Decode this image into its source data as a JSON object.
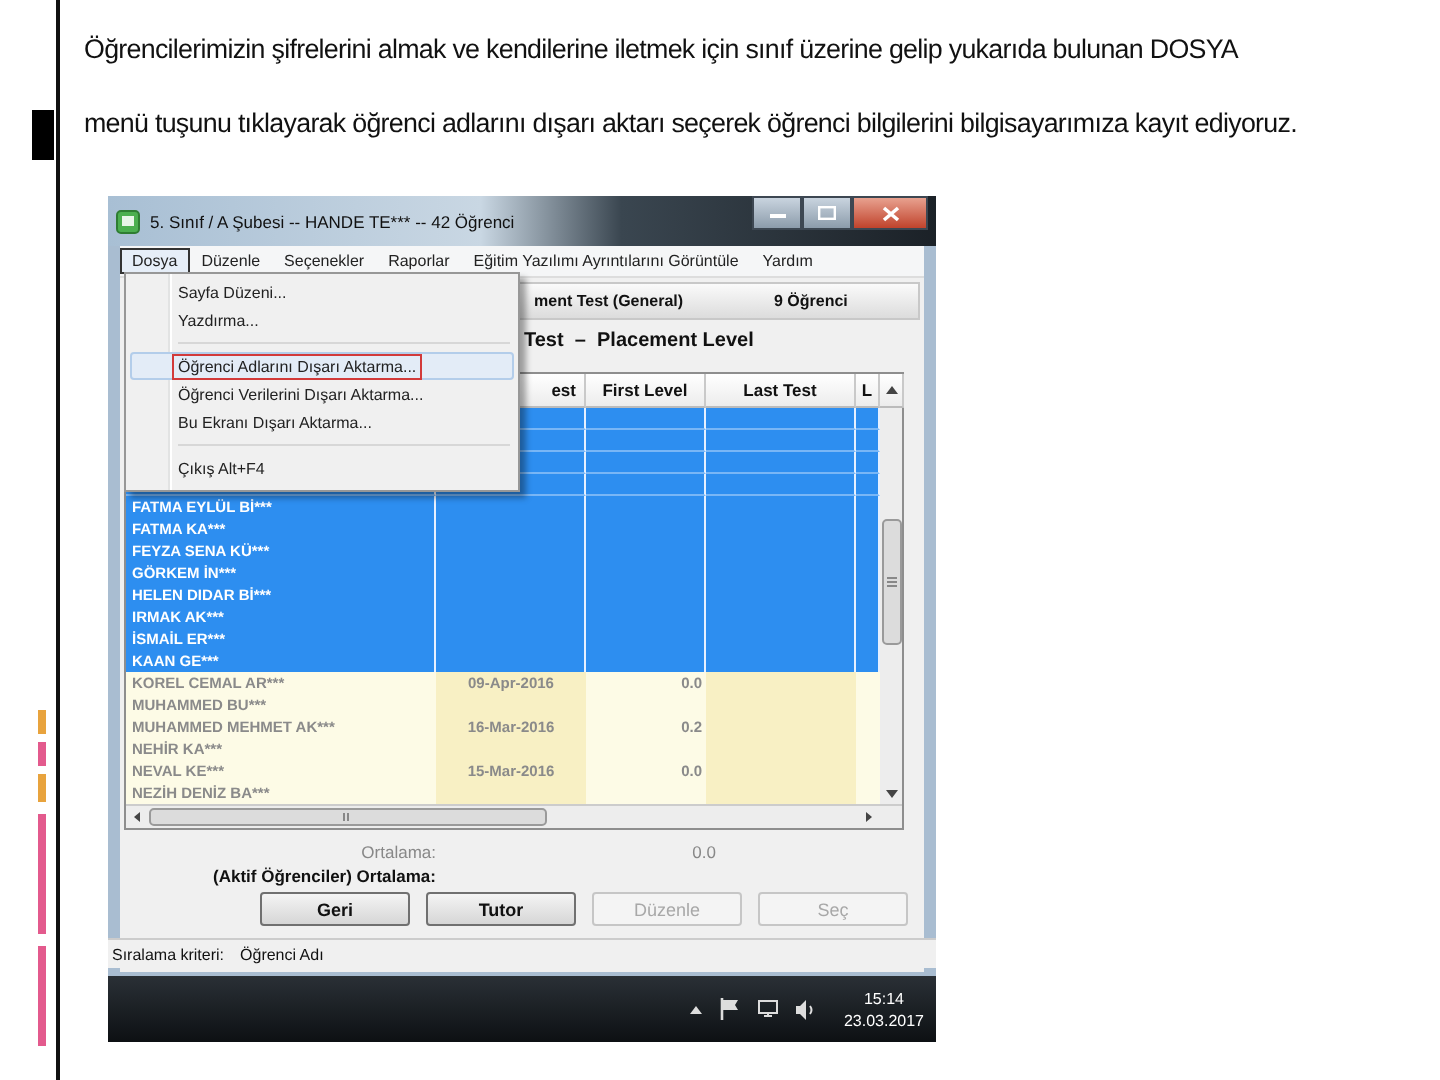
{
  "slide": {
    "lines": [
      "Öğrencilerimizin şifrelerini almak ve kendilerine  iletmek için sınıf üzerine gelip yukarıda bulunan DOSYA",
      "menü tuşunu tıklayarak öğrenci adlarını dışarı aktarı seçerek öğrenci bilgilerini bilgisayarımıza kayıt ediyoruz."
    ]
  },
  "window": {
    "title": "5. Sınıf / A Şubesi -- HANDE TE*** -- 42 Öğrenci"
  },
  "menu_bar": [
    {
      "label": "Dosya",
      "selected": true
    },
    {
      "label": "Düzenle",
      "selected": false
    },
    {
      "label": "Seçenekler",
      "selected": false
    },
    {
      "label": "Raporlar",
      "selected": false
    },
    {
      "label": "Eğitim Yazılımı Ayrıntılarını Görüntüle",
      "selected": false
    },
    {
      "label": "Yardım",
      "selected": false
    }
  ],
  "dropdown": [
    {
      "kind": "item",
      "label": "Sayfa Düzeni...",
      "selected": false,
      "outlined": false
    },
    {
      "kind": "item",
      "label": "Yazdırma...",
      "selected": false,
      "outlined": false
    },
    {
      "kind": "separator"
    },
    {
      "kind": "item",
      "label": "Öğrenci Adlarını Dışarı Aktarma...",
      "selected": true,
      "outlined": true
    },
    {
      "kind": "item",
      "label": "Öğrenci Verilerini Dışarı Aktarma...",
      "selected": false,
      "outlined": false
    },
    {
      "kind": "item",
      "label": "Bu Ekranı Dışarı Aktarma...",
      "selected": false,
      "outlined": false
    },
    {
      "kind": "separator"
    },
    {
      "kind": "item",
      "label": "Çıkış Alt+F4",
      "selected": false,
      "outlined": false
    }
  ],
  "test_info": {
    "name": "ment Test (General)",
    "count": "9 Öğrenci"
  },
  "subtitle": "Test  –  Placement Level",
  "table": {
    "columns": [
      "est",
      "First Level",
      "Last Test",
      "L"
    ],
    "rows": [
      {
        "selected": true
      },
      {
        "selected": true
      },
      {
        "selected": true
      },
      {
        "selected": true
      },
      {
        "name": "FATMA EYLÜL Bİ***",
        "selected": true
      },
      {
        "name": "FATMA KA***",
        "selected": true
      },
      {
        "name": "FEYZA SENA KÜ***",
        "selected": true
      },
      {
        "name": "GÖRKEM İN***",
        "selected": true
      },
      {
        "name": "HELEN DIDAR Bİ***",
        "selected": true
      },
      {
        "name": "IRMAK AK***",
        "selected": true
      },
      {
        "name": "İSMAİL ER***",
        "selected": true
      },
      {
        "name": "KAAN GE***",
        "selected": true
      },
      {
        "name": "KOREL CEMAL AR***",
        "test": "09-Apr-2016",
        "first_level": "0.0",
        "selected": false
      },
      {
        "name": "MUHAMMED BU***",
        "selected": false
      },
      {
        "name": "MUHAMMED MEHMET AK***",
        "test": "16-Mar-2016",
        "first_level": "0.2",
        "selected": false
      },
      {
        "name": "NEHİR KA***",
        "selected": false
      },
      {
        "name": "NEVAL KE***",
        "test": "15-Mar-2016",
        "first_level": "0.0",
        "selected": false
      },
      {
        "name": "NEZİH DENİZ BA***",
        "selected": false
      }
    ]
  },
  "averages": [
    {
      "label": "Ortalama:",
      "value": "0.0",
      "bold": false
    },
    {
      "label": "(Aktif Öğrenciler) Ortalama:",
      "bold": true
    }
  ],
  "buttons": [
    {
      "label": "Geri",
      "disabled": false
    },
    {
      "label": "Tutor",
      "disabled": false
    },
    {
      "label": "Düzenle",
      "disabled": true
    },
    {
      "label": "Seç",
      "disabled": true
    }
  ],
  "status_bar": {
    "label": "Sıralama kriteri:",
    "value": "Öğrenci Adı"
  },
  "taskbar": {
    "time": "15:14",
    "date": "23.03.2017"
  }
}
